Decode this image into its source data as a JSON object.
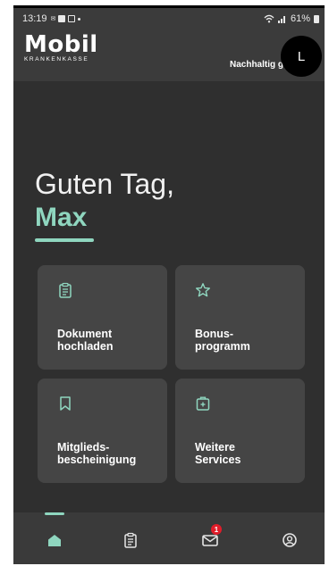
{
  "status_bar": {
    "time": "13:19",
    "left_icons": [
      "message-icon",
      "gallery-icon",
      "screenshot-icon"
    ],
    "right_icons": [
      "wifi-icon",
      "signal-icon",
      "battery-icon"
    ],
    "battery": "61%"
  },
  "header": {
    "logo": "Mobil",
    "logo_sub": "KRANKENKASSE",
    "tagline": "Nachhaltig g",
    "avatar_initial": "L"
  },
  "greeting": {
    "line1": "Guten Tag,",
    "name": "Max"
  },
  "tiles": [
    {
      "label": "Dokument\nhochladen",
      "icon": "clipboard-icon"
    },
    {
      "label": "Bonus-\nprogramm",
      "icon": "star-icon"
    },
    {
      "label": "Mitglieds-\nbescheinigung",
      "icon": "bookmark-icon"
    },
    {
      "label": "Weitere\nServices",
      "icon": "medical-case-icon"
    }
  ],
  "bottom_nav": {
    "items": [
      {
        "icon": "home-icon",
        "active": true
      },
      {
        "icon": "clipboard-icon",
        "active": false
      },
      {
        "icon": "mail-icon",
        "active": false
      },
      {
        "icon": "profile-icon",
        "active": false
      }
    ],
    "mail_badge": "1"
  },
  "colors": {
    "accent": "#8fd6bf",
    "background": "#2f2f2f",
    "tile": "#454545",
    "badge": "#e11d2a"
  }
}
